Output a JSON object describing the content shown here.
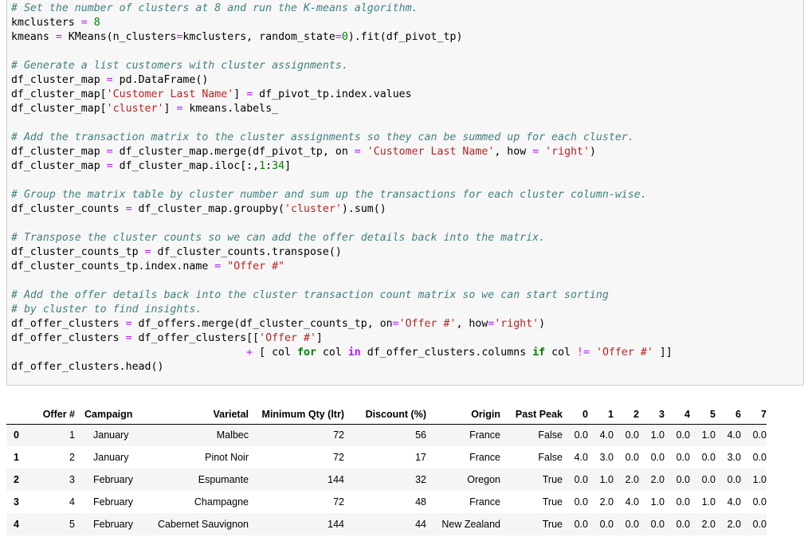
{
  "code": {
    "lines": [
      {
        "tokens": [
          [
            "c",
            "# Set the number of clusters at 8 and run the K-means algorithm."
          ]
        ]
      },
      {
        "tokens": [
          [
            "p",
            "kmclusters "
          ],
          [
            "o",
            "="
          ],
          [
            "p",
            " "
          ],
          [
            "n",
            "8"
          ]
        ]
      },
      {
        "tokens": [
          [
            "p",
            "kmeans "
          ],
          [
            "o",
            "="
          ],
          [
            "p",
            " KMeans(n_clusters"
          ],
          [
            "o",
            "="
          ],
          [
            "p",
            "kmclusters, random_state"
          ],
          [
            "o",
            "="
          ],
          [
            "n",
            "0"
          ],
          [
            "p",
            ")."
          ],
          [
            "p",
            "fit(df_pivot_tp)"
          ]
        ]
      },
      {
        "tokens": [
          [
            "p",
            ""
          ]
        ]
      },
      {
        "tokens": [
          [
            "c",
            "# Generate a list customers with cluster assignments."
          ]
        ]
      },
      {
        "tokens": [
          [
            "p",
            "df_cluster_map "
          ],
          [
            "o",
            "="
          ],
          [
            "p",
            " pd."
          ],
          [
            "p",
            "DataFrame()"
          ]
        ]
      },
      {
        "tokens": [
          [
            "p",
            "df_cluster_map["
          ],
          [
            "s",
            "'Customer Last Name'"
          ],
          [
            "p",
            "] "
          ],
          [
            "o",
            "="
          ],
          [
            "p",
            " df_pivot_tp."
          ],
          [
            "p",
            "index."
          ],
          [
            "p",
            "values"
          ]
        ]
      },
      {
        "tokens": [
          [
            "p",
            "df_cluster_map["
          ],
          [
            "s",
            "'cluster'"
          ],
          [
            "p",
            "] "
          ],
          [
            "o",
            "="
          ],
          [
            "p",
            " kmeans."
          ],
          [
            "p",
            "labels_"
          ]
        ]
      },
      {
        "tokens": [
          [
            "p",
            ""
          ]
        ]
      },
      {
        "tokens": [
          [
            "c",
            "# Add the transaction matrix to the cluster assignments so they can be summed up for each cluster."
          ]
        ]
      },
      {
        "tokens": [
          [
            "p",
            "df_cluster_map "
          ],
          [
            "o",
            "="
          ],
          [
            "p",
            " df_cluster_map."
          ],
          [
            "p",
            "merge(df_pivot_tp, on "
          ],
          [
            "o",
            "="
          ],
          [
            "p",
            " "
          ],
          [
            "s",
            "'Customer Last Name'"
          ],
          [
            "p",
            ", how "
          ],
          [
            "o",
            "="
          ],
          [
            "p",
            " "
          ],
          [
            "s",
            "'right'"
          ],
          [
            "p",
            ")"
          ]
        ]
      },
      {
        "tokens": [
          [
            "p",
            "df_cluster_map "
          ],
          [
            "o",
            "="
          ],
          [
            "p",
            " df_cluster_map."
          ],
          [
            "p",
            "iloc[:,"
          ],
          [
            "n",
            "1"
          ],
          [
            "p",
            ":"
          ],
          [
            "n",
            "34"
          ],
          [
            "p",
            "]"
          ]
        ]
      },
      {
        "tokens": [
          [
            "p",
            ""
          ]
        ]
      },
      {
        "tokens": [
          [
            "c",
            "# Group the matrix table by cluster number and sum up the transactions for each cluster column-wise."
          ]
        ]
      },
      {
        "tokens": [
          [
            "p",
            "df_cluster_counts "
          ],
          [
            "o",
            "="
          ],
          [
            "p",
            " df_cluster_map."
          ],
          [
            "p",
            "groupby("
          ],
          [
            "s",
            "'cluster'"
          ],
          [
            "p",
            ")."
          ],
          [
            "p",
            "sum()"
          ]
        ]
      },
      {
        "tokens": [
          [
            "p",
            ""
          ]
        ]
      },
      {
        "tokens": [
          [
            "c",
            "# Transpose the cluster counts so we can add the offer details back into the matrix."
          ]
        ]
      },
      {
        "tokens": [
          [
            "p",
            "df_cluster_counts_tp "
          ],
          [
            "o",
            "="
          ],
          [
            "p",
            " df_cluster_counts."
          ],
          [
            "p",
            "transpose()"
          ]
        ]
      },
      {
        "tokens": [
          [
            "p",
            "df_cluster_counts_tp."
          ],
          [
            "p",
            "index."
          ],
          [
            "p",
            "name "
          ],
          [
            "o",
            "="
          ],
          [
            "p",
            " "
          ],
          [
            "s",
            "\"Offer #\""
          ]
        ]
      },
      {
        "tokens": [
          [
            "p",
            ""
          ]
        ]
      },
      {
        "tokens": [
          [
            "c",
            "# Add the offer details back into the cluster transaction count matrix so we can start sorting"
          ]
        ]
      },
      {
        "tokens": [
          [
            "c",
            "# by cluster to find insights."
          ]
        ]
      },
      {
        "tokens": [
          [
            "p",
            "df_offer_clusters "
          ],
          [
            "o",
            "="
          ],
          [
            "p",
            " df_offers."
          ],
          [
            "p",
            "merge(df_cluster_counts_tp, on"
          ],
          [
            "o",
            "="
          ],
          [
            "s",
            "'Offer #'"
          ],
          [
            "p",
            ", how"
          ],
          [
            "o",
            "="
          ],
          [
            "s",
            "'right'"
          ],
          [
            "p",
            ")"
          ]
        ]
      },
      {
        "tokens": [
          [
            "p",
            "df_offer_clusters "
          ],
          [
            "o",
            "="
          ],
          [
            "p",
            " df_offer_clusters[["
          ],
          [
            "s",
            "'Offer #'"
          ],
          [
            "p",
            "]"
          ]
        ]
      },
      {
        "tokens": [
          [
            "p",
            "                                     "
          ],
          [
            "o",
            "+"
          ],
          [
            "p",
            " [ col "
          ],
          [
            "k",
            "for"
          ],
          [
            "p",
            " col "
          ],
          [
            "ow",
            "in"
          ],
          [
            "p",
            " df_offer_clusters."
          ],
          [
            "p",
            "columns "
          ],
          [
            "k",
            "if"
          ],
          [
            "p",
            " col "
          ],
          [
            "o",
            "!="
          ],
          [
            "p",
            " "
          ],
          [
            "s",
            "'Offer #'"
          ],
          [
            "p",
            " ]]"
          ]
        ]
      },
      {
        "tokens": [
          [
            "p",
            "df_offer_clusters."
          ],
          [
            "p",
            "head()"
          ]
        ]
      }
    ]
  },
  "table": {
    "columns": [
      "",
      "Offer #",
      "Campaign",
      "Varietal",
      "Minimum Qty (ltr)",
      "Discount (%)",
      "Origin",
      "Past Peak",
      "0",
      "1",
      "2",
      "3",
      "4",
      "5",
      "6",
      "7"
    ],
    "rows": [
      {
        "index": "0",
        "cells": [
          "1",
          "January",
          "Malbec",
          "72",
          "56",
          "France",
          "False",
          "0.0",
          "4.0",
          "0.0",
          "1.0",
          "0.0",
          "1.0",
          "4.0",
          "0.0"
        ]
      },
      {
        "index": "1",
        "cells": [
          "2",
          "January",
          "Pinot Noir",
          "72",
          "17",
          "France",
          "False",
          "4.0",
          "3.0",
          "0.0",
          "0.0",
          "0.0",
          "0.0",
          "3.0",
          "0.0"
        ]
      },
      {
        "index": "2",
        "cells": [
          "3",
          "February",
          "Espumante",
          "144",
          "32",
          "Oregon",
          "True",
          "0.0",
          "1.0",
          "2.0",
          "2.0",
          "0.0",
          "0.0",
          "0.0",
          "1.0"
        ]
      },
      {
        "index": "3",
        "cells": [
          "4",
          "February",
          "Champagne",
          "72",
          "48",
          "France",
          "True",
          "0.0",
          "2.0",
          "4.0",
          "1.0",
          "0.0",
          "1.0",
          "4.0",
          "0.0"
        ]
      },
      {
        "index": "4",
        "cells": [
          "5",
          "February",
          "Cabernet Sauvignon",
          "144",
          "44",
          "New Zealand",
          "True",
          "0.0",
          "0.0",
          "0.0",
          "0.0",
          "0.0",
          "2.0",
          "2.0",
          "0.0"
        ]
      }
    ]
  }
}
